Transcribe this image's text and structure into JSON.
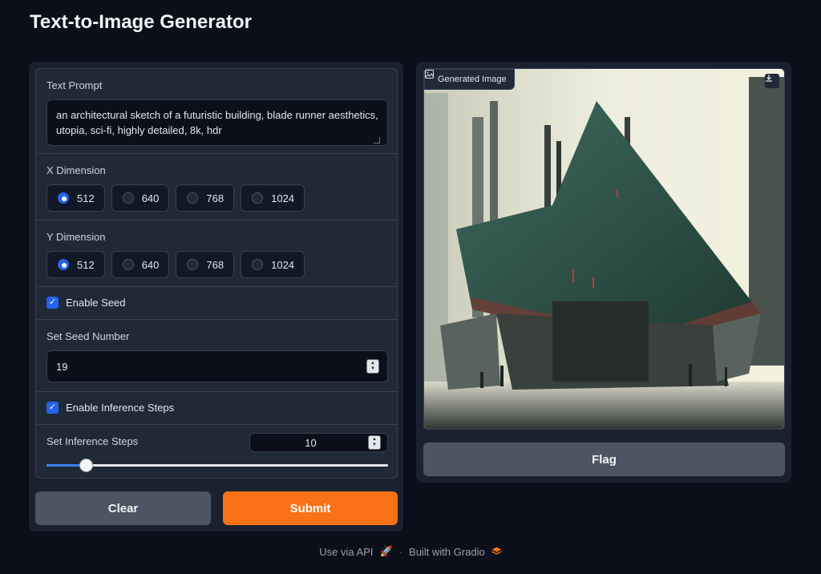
{
  "page": {
    "title": "Text-to-Image Generator"
  },
  "prompt": {
    "label": "Text Prompt",
    "value": "an architectural sketch of a futuristic building, blade runner aesthetics, utopia, sci-fi, highly detailed, 8k, hdr"
  },
  "x_dimension": {
    "label": "X Dimension",
    "options": [
      "512",
      "640",
      "768",
      "1024"
    ],
    "selected": "512"
  },
  "y_dimension": {
    "label": "Y Dimension",
    "options": [
      "512",
      "640",
      "768",
      "1024"
    ],
    "selected": "512"
  },
  "seed": {
    "enable_label": "Enable Seed",
    "enabled": true,
    "number_label": "Set Seed Number",
    "value": "19"
  },
  "inference": {
    "enable_label": "Enable Inference Steps",
    "enabled": true,
    "steps_label": "Set Inference Steps",
    "value": "10",
    "slider_fraction": 0.115
  },
  "buttons": {
    "clear": "Clear",
    "submit": "Submit",
    "flag": "Flag"
  },
  "output": {
    "label": "Generated Image"
  },
  "footer": {
    "api": "Use via API",
    "sep": "·",
    "built": "Built with Gradio"
  },
  "colors": {
    "accent": "#f97316",
    "primary": "#2563eb",
    "bg": "#0b0f19"
  }
}
